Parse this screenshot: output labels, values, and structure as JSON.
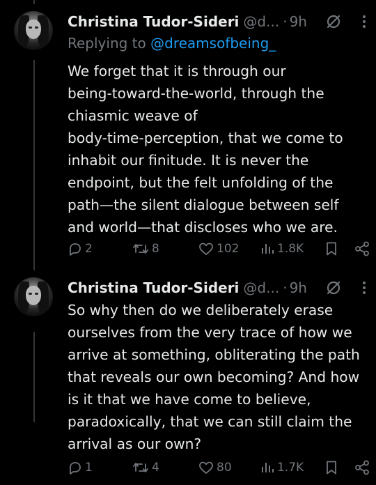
{
  "tweets": [
    {
      "author_name": "Christina Tudor-Sideri",
      "author_handle": "@d...",
      "separator": "·",
      "time": "9h",
      "replying_prefix": "Replying to",
      "replying_to": "@dreamsofbeing_",
      "text_lines": [
        "We forget that it is through our",
        "being-toward-the-world, through the",
        "chiasmic weave of",
        "body-time-perception, that we come to",
        "inhabit our finitude. It is never the",
        "endpoint, but the felt unfolding of the",
        "path—the silent dialogue between self",
        "and world—that discloses who we are."
      ],
      "replies": "2",
      "reposts": "8",
      "likes": "102",
      "views": "1.8K"
    },
    {
      "author_name": "Christina Tudor-Sideri",
      "author_handle": "@d...",
      "separator": "·",
      "time": "9h",
      "text_lines": [
        "So why then do we deliberately erase",
        "ourselves from the very trace of how we",
        "arrive at something, obliterating the path",
        "that reveals our own becoming? And how",
        "is it that we have come to believe,",
        "paradoxically, that we can still claim the",
        "arrival as our own?"
      ],
      "replies": "1",
      "reposts": "4",
      "likes": "80",
      "views": "1.7K"
    }
  ],
  "colors": {
    "background": "#000000",
    "text": "#e7e9ea",
    "muted": "#71767b",
    "link": "#1d9bf0",
    "thread_line": "#333639"
  },
  "icons": [
    "grok-icon",
    "more-icon",
    "reply-icon",
    "repost-icon",
    "like-icon",
    "views-icon",
    "bookmark-icon",
    "share-icon"
  ]
}
